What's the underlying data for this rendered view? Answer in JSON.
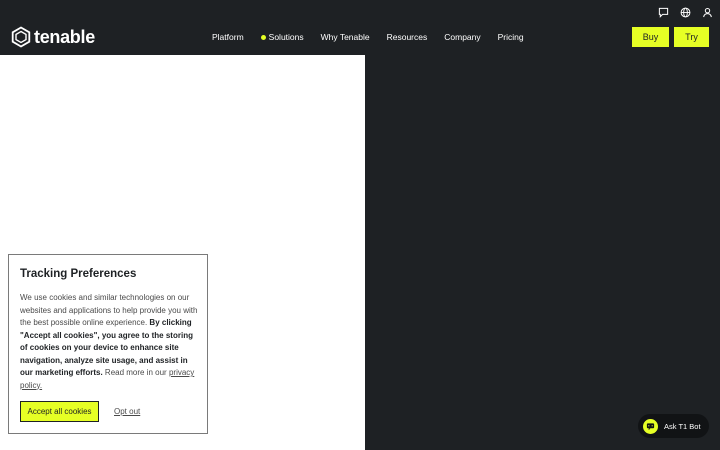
{
  "header": {
    "logo_text": "tenable",
    "nav": [
      {
        "label": "Platform"
      },
      {
        "label": "Solutions"
      },
      {
        "label": "Why Tenable"
      },
      {
        "label": "Resources"
      },
      {
        "label": "Company"
      },
      {
        "label": "Pricing"
      }
    ],
    "buy_label": "Buy",
    "try_label": "Try",
    "utility_icons": [
      "chat-icon",
      "globe-icon",
      "user-icon"
    ]
  },
  "cookie_banner": {
    "title": "Tracking Preferences",
    "body_intro": "We use cookies and similar technologies on our websites and applications to help provide you with the best possible online experience. ",
    "body_bold": "By clicking \"Accept all cookies\", you agree to the storing of cookies on your device to enhance site navigation, analyze site usage, and assist in our marketing efforts.",
    "body_outro": " Read more in our ",
    "privacy_link": "privacy policy.",
    "accept_label": "Accept all cookies",
    "optout_label": "Opt out"
  },
  "chatbot": {
    "label": "Ask T1 Bot"
  },
  "colors": {
    "accent": "#e6ff25",
    "dark": "#1e2124"
  }
}
